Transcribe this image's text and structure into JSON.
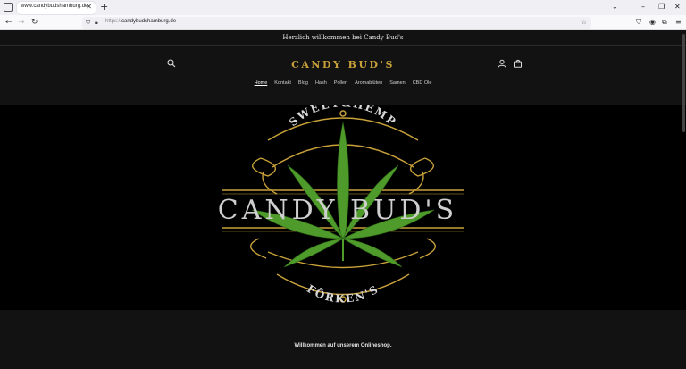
{
  "browser": {
    "tab_title": "www.candybudshamburg.de",
    "url_protocol": "https://",
    "url_host": "candybudshamburg.de"
  },
  "announcement": "Herzlich willkommen bei Candy Bud's",
  "header": {
    "logo": "CANDY BUD'S",
    "menu": [
      {
        "label": "Home",
        "active": true
      },
      {
        "label": "Kontakt"
      },
      {
        "label": "Blog"
      },
      {
        "label": "Hash"
      },
      {
        "label": "Pollen"
      },
      {
        "label": "Aromablüten"
      },
      {
        "label": "Samen"
      },
      {
        "label": "CBD Öle"
      }
    ]
  },
  "hero": {
    "top_text": "SWEET&HEMP",
    "brand_text": "CANDY BUD'S",
    "bottom_text": "FÖRKEN'S",
    "gold": "#c9a13a",
    "leaf": "#4e9a2a"
  },
  "welcome_text": "Willkommen auf unserem Onlineshop."
}
